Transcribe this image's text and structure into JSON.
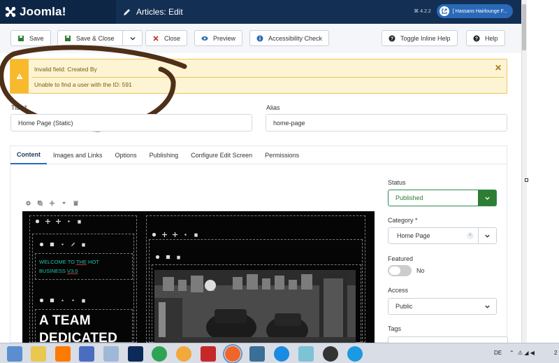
{
  "header": {
    "brand": "Joomla!",
    "title": "Articles: Edit",
    "version": "⌘ 4.2.2",
    "site_name": "[ Hassans Hairlounge F..."
  },
  "toolbar": {
    "save": "Save",
    "save_close": "Save & Close",
    "close": "Close",
    "preview": "Preview",
    "accessibility": "Accessibility Check",
    "toggle_help": "Toggle Inline Help",
    "help": "Help"
  },
  "alert": {
    "title": "Invalid field: Created By",
    "message": "Unable to find a user with the ID: 591"
  },
  "form": {
    "title_label": "Title *",
    "title_value": "Home Page (Static)",
    "alias_label": "Alias",
    "alias_value": "home-page"
  },
  "tabs": [
    "Content",
    "Images and Links",
    "Options",
    "Publishing",
    "Configure Edit Screen",
    "Permissions"
  ],
  "preview": {
    "welcome_a": "WELCOME TO ",
    "welcome_u": "THE",
    "welcome_b": " HOT",
    "welcome_c": "BUSINESS ",
    "welcome_d": "V3.0",
    "headline_1": "A TEAM",
    "headline_2": "DEDICATED"
  },
  "sidebar": {
    "status_label": "Status",
    "status_value": "Published",
    "category_label": "Category *",
    "category_value": "Home Page",
    "featured_label": "Featured",
    "featured_value": "No",
    "access_label": "Access",
    "access_value": "Public",
    "tags_label": "Tags"
  },
  "taskbar": {
    "lang": "DE",
    "clock_fragment": "2"
  },
  "colors": {
    "header": "#132f53",
    "brand_bg": "#0e2646",
    "warning": "#f9b92c",
    "published": "#2e7d32",
    "accent": "#2a69b8"
  }
}
